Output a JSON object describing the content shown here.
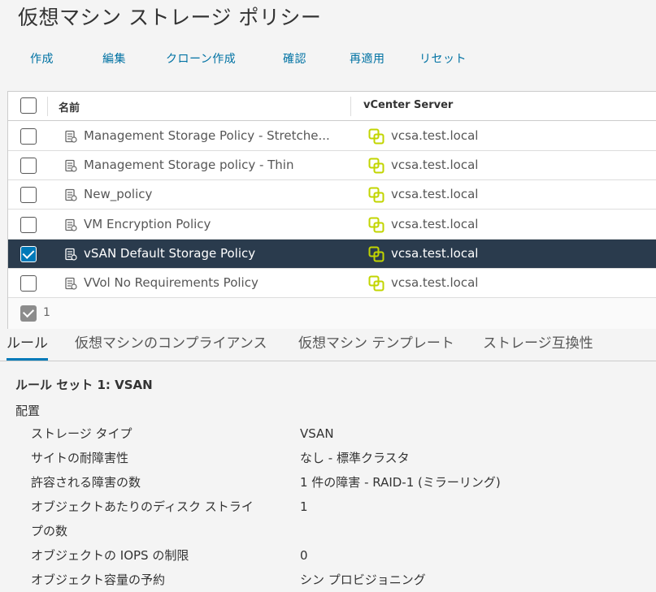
{
  "page": {
    "title": "仮想マシン ストレージ ポリシー"
  },
  "toolbar": {
    "create": "作成",
    "edit": "編集",
    "clone": "クローン作成",
    "check": "確認",
    "reapply": "再適用",
    "reset": "リセット"
  },
  "grid": {
    "columns": {
      "name": "名前",
      "vcenter": "vCenter Server"
    },
    "rows": [
      {
        "name": "Management Storage Policy - Stretche...",
        "vcenter": "vcsa.test.local",
        "selected": false
      },
      {
        "name": "Management Storage policy - Thin",
        "vcenter": "vcsa.test.local",
        "selected": false
      },
      {
        "name": "New_policy",
        "vcenter": "vcsa.test.local",
        "selected": false
      },
      {
        "name": "VM Encryption Policy",
        "vcenter": "vcsa.test.local",
        "selected": false
      },
      {
        "name": "vSAN Default Storage Policy",
        "vcenter": "vcsa.test.local",
        "selected": true
      },
      {
        "name": "VVol No Requirements Policy",
        "vcenter": "vcsa.test.local",
        "selected": false
      }
    ],
    "footer": {
      "selected_count": "1"
    }
  },
  "tabs": {
    "rules": "ルール",
    "vm_compliance": "仮想マシンのコンプライアンス",
    "vm_templates": "仮想マシン テンプレート",
    "storage_compat": "ストレージ互換性"
  },
  "details": {
    "rule_set": "ルール セット 1: VSAN",
    "section": "配置",
    "props": [
      {
        "label": "ストレージ タイプ",
        "value": "VSAN"
      },
      {
        "label": "サイトの耐障害性",
        "value": "なし - 標準クラスタ"
      },
      {
        "label": "許容される障害の数",
        "value": "1 件の障害 - RAID-1 (ミラーリング)"
      },
      {
        "label": "オブジェクトあたりのディスク ストライ",
        "value": "1"
      },
      {
        "label": "プの数",
        "value": ""
      },
      {
        "label": "オブジェクトの IOPS の制限",
        "value": "0"
      },
      {
        "label": "オブジェクト容量の予約",
        "value": "シン プロビジョニング"
      }
    ]
  },
  "colors": {
    "accent": "#0079b8",
    "selected_row": "#2a3b4d",
    "link": "#0072a3",
    "vc_icon": "#c2d500"
  }
}
